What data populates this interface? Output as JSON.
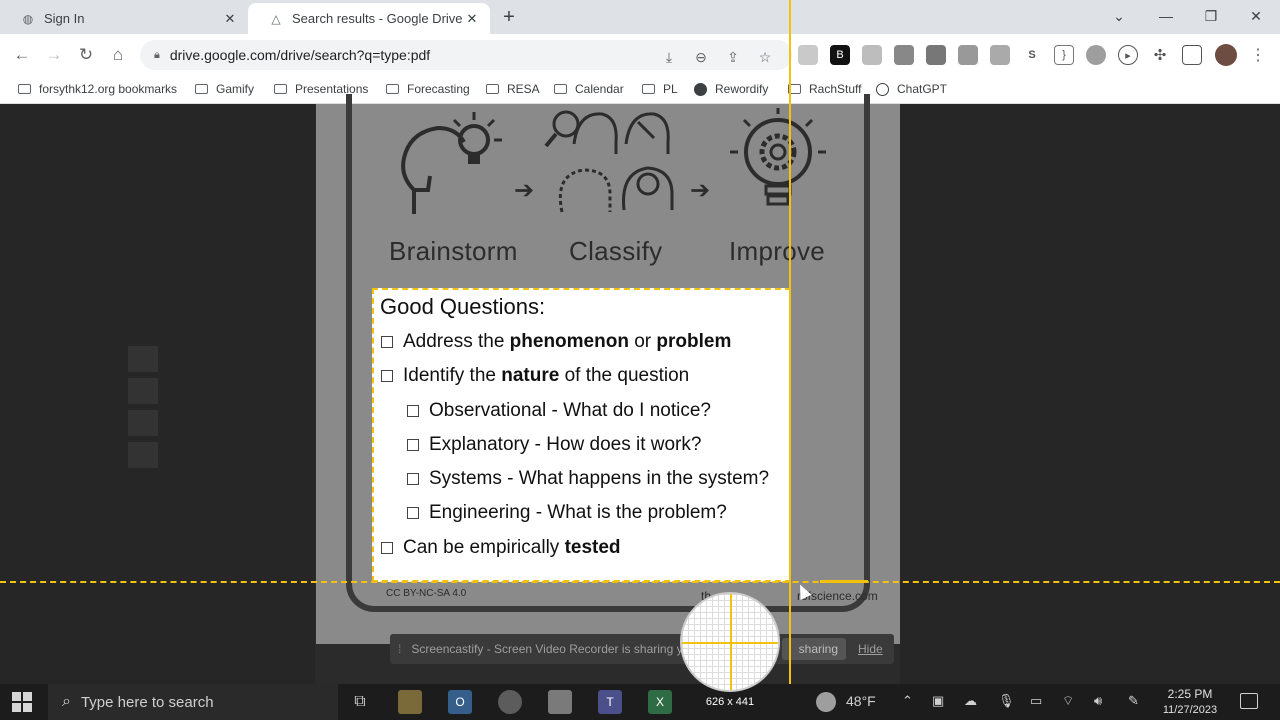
{
  "browser": {
    "tabs": [
      {
        "title": "Sign In",
        "active": false
      },
      {
        "title": "Search results - Google Drive",
        "active": true
      }
    ],
    "new_tab_icon": "plus-icon",
    "url": "drive.google.com/drive/search?q=type:pdf",
    "bookmarks": [
      {
        "label": "forsythk12.org bookmarks",
        "icon": "folder-icon"
      },
      {
        "label": "Gamify",
        "icon": "folder-icon"
      },
      {
        "label": "Presentations",
        "icon": "folder-icon"
      },
      {
        "label": "Forecasting",
        "icon": "folder-icon"
      },
      {
        "label": "RESA",
        "icon": "folder-icon"
      },
      {
        "label": "Calendar",
        "icon": "folder-icon"
      },
      {
        "label": "PL",
        "icon": "folder-icon"
      },
      {
        "label": "Rewordify",
        "icon": "globe-icon"
      },
      {
        "label": "RachStuff",
        "icon": "folder-icon"
      },
      {
        "label": "ChatGPT",
        "icon": "chatgpt-icon"
      }
    ]
  },
  "document": {
    "steps": [
      "Brainstorm",
      "Classify",
      "Improve"
    ],
    "license": "CC BY-NC-SA 4.0",
    "site_fragment": "th",
    "site_suffix": "rofscience.com",
    "good_questions": {
      "title": "Good Questions:",
      "item1_pre": "Address the ",
      "item1_b1": "phenomenon",
      "item1_mid": " or ",
      "item1_b2": "problem",
      "item2_pre": "Identify the ",
      "item2_b": "nature",
      "item2_post": " of the question",
      "sub1": "Observational - What do I notice?",
      "sub2": "Explanatory - How does it work?",
      "sub3": "Systems - What happens in the system?",
      "sub4": "Engineering - What is the problem?",
      "item3_pre": "Can be empirically ",
      "item3_b": "tested"
    }
  },
  "capture_tool": {
    "dimensions": "626 x 441"
  },
  "screencastify": {
    "message": "Screencastify - Screen Video Recorder is sharing y",
    "stop_label": "sharing",
    "hide_label": "Hide"
  },
  "taskbar": {
    "search_placeholder": "Type here to search",
    "weather": "48°F",
    "time": "2:25 PM",
    "date": "11/27/2023"
  },
  "colors": {
    "guide": "#f4c20d",
    "taskbar": "#1c1c1c",
    "chrome_tabstrip": "#dee1e6"
  }
}
